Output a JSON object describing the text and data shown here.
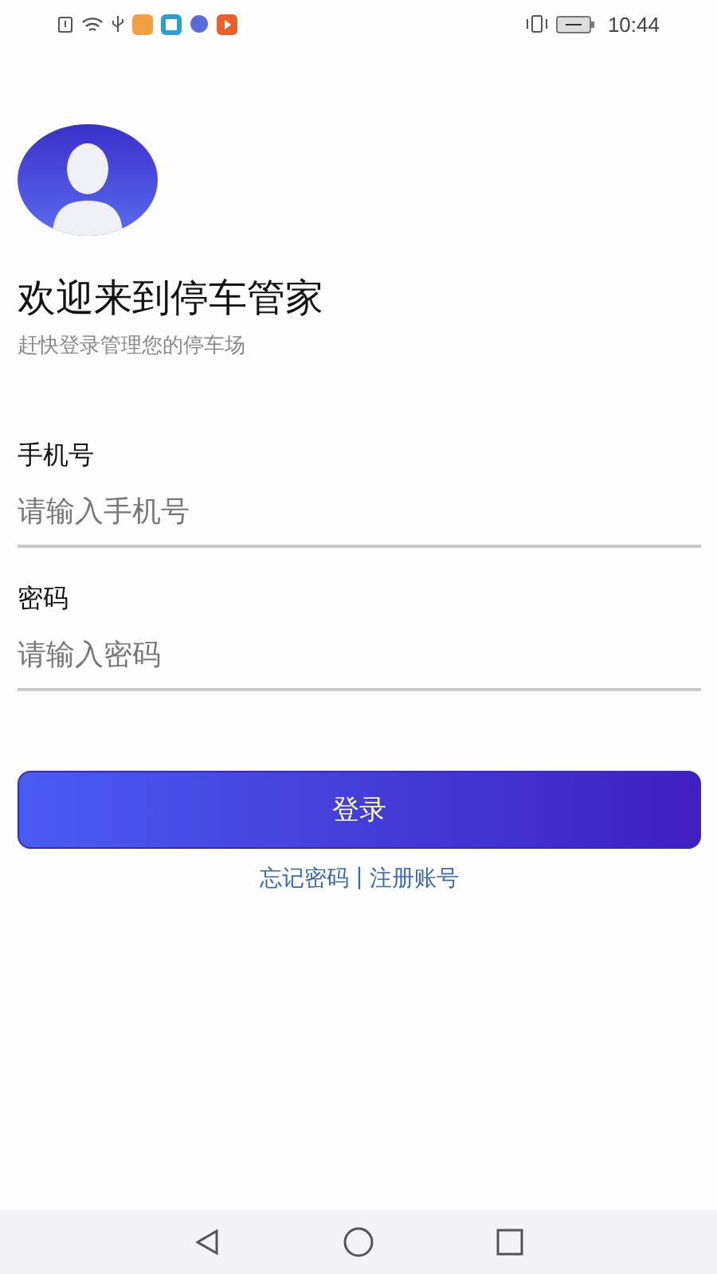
{
  "status_bar": {
    "time": "10:44"
  },
  "header": {
    "title": "欢迎来到停车管家",
    "subtitle": "赶快登录管理您的停车场"
  },
  "fields": [
    {
      "label": "手机号",
      "placeholder": "请输入手机号"
    },
    {
      "label": "密码",
      "placeholder": "请输入密码"
    }
  ],
  "login_button": "登录",
  "links": {
    "forgot": "忘记密码",
    "separator": "|",
    "register": "注册账号"
  }
}
